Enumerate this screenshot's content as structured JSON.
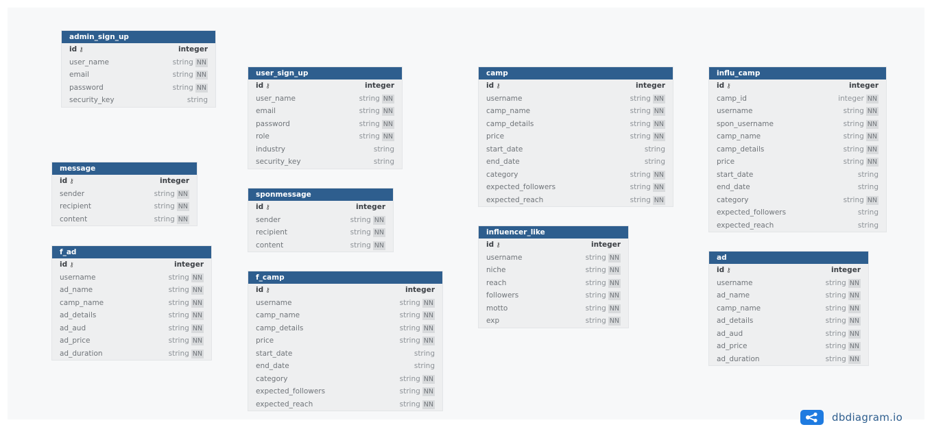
{
  "tables": [
    {
      "name": "admin_sign_up",
      "fields": [
        {
          "name": "id",
          "type": "integer",
          "pk": true
        },
        {
          "name": "user_name",
          "type": "string",
          "nn": true
        },
        {
          "name": "email",
          "type": "string",
          "nn": true
        },
        {
          "name": "password",
          "type": "string",
          "nn": true
        },
        {
          "name": "security_key",
          "type": "string"
        }
      ]
    },
    {
      "name": "message",
      "fields": [
        {
          "name": "id",
          "type": "integer",
          "pk": true
        },
        {
          "name": "sender",
          "type": "string",
          "nn": true
        },
        {
          "name": "recipient",
          "type": "string",
          "nn": true
        },
        {
          "name": "content",
          "type": "string",
          "nn": true
        }
      ]
    },
    {
      "name": "f_ad",
      "fields": [
        {
          "name": "id",
          "type": "integer",
          "pk": true
        },
        {
          "name": "username",
          "type": "string",
          "nn": true
        },
        {
          "name": "ad_name",
          "type": "string",
          "nn": true
        },
        {
          "name": "camp_name",
          "type": "string",
          "nn": true
        },
        {
          "name": "ad_details",
          "type": "string",
          "nn": true
        },
        {
          "name": "ad_aud",
          "type": "string",
          "nn": true
        },
        {
          "name": "ad_price",
          "type": "string",
          "nn": true
        },
        {
          "name": "ad_duration",
          "type": "string",
          "nn": true
        }
      ]
    },
    {
      "name": "user_sign_up",
      "fields": [
        {
          "name": "id",
          "type": "integer",
          "pk": true
        },
        {
          "name": "user_name",
          "type": "string",
          "nn": true
        },
        {
          "name": "email",
          "type": "string",
          "nn": true
        },
        {
          "name": "password",
          "type": "string",
          "nn": true
        },
        {
          "name": "role",
          "type": "string",
          "nn": true
        },
        {
          "name": "industry",
          "type": "string"
        },
        {
          "name": "security_key",
          "type": "string"
        }
      ]
    },
    {
      "name": "sponmessage",
      "fields": [
        {
          "name": "id",
          "type": "integer",
          "pk": true
        },
        {
          "name": "sender",
          "type": "string",
          "nn": true
        },
        {
          "name": "recipient",
          "type": "string",
          "nn": true
        },
        {
          "name": "content",
          "type": "string",
          "nn": true
        }
      ]
    },
    {
      "name": "f_camp",
      "fields": [
        {
          "name": "id",
          "type": "integer",
          "pk": true
        },
        {
          "name": "username",
          "type": "string",
          "nn": true
        },
        {
          "name": "camp_name",
          "type": "string",
          "nn": true
        },
        {
          "name": "camp_details",
          "type": "string",
          "nn": true
        },
        {
          "name": "price",
          "type": "string",
          "nn": true
        },
        {
          "name": "start_date",
          "type": "string"
        },
        {
          "name": "end_date",
          "type": "string"
        },
        {
          "name": "category",
          "type": "string",
          "nn": true
        },
        {
          "name": "expected_followers",
          "type": "string",
          "nn": true
        },
        {
          "name": "expected_reach",
          "type": "string",
          "nn": true
        }
      ]
    },
    {
      "name": "camp",
      "fields": [
        {
          "name": "id",
          "type": "integer",
          "pk": true
        },
        {
          "name": "username",
          "type": "string",
          "nn": true
        },
        {
          "name": "camp_name",
          "type": "string",
          "nn": true
        },
        {
          "name": "camp_details",
          "type": "string",
          "nn": true
        },
        {
          "name": "price",
          "type": "string",
          "nn": true
        },
        {
          "name": "start_date",
          "type": "string"
        },
        {
          "name": "end_date",
          "type": "string"
        },
        {
          "name": "category",
          "type": "string",
          "nn": true
        },
        {
          "name": "expected_followers",
          "type": "string",
          "nn": true
        },
        {
          "name": "expected_reach",
          "type": "string",
          "nn": true
        }
      ]
    },
    {
      "name": "influencer_like",
      "fields": [
        {
          "name": "id",
          "type": "integer",
          "pk": true
        },
        {
          "name": "username",
          "type": "string",
          "nn": true
        },
        {
          "name": "niche",
          "type": "string",
          "nn": true
        },
        {
          "name": "reach",
          "type": "string",
          "nn": true
        },
        {
          "name": "followers",
          "type": "string",
          "nn": true
        },
        {
          "name": "motto",
          "type": "string",
          "nn": true
        },
        {
          "name": "exp",
          "type": "string",
          "nn": true
        }
      ]
    },
    {
      "name": "influ_camp",
      "fields": [
        {
          "name": "id",
          "type": "integer",
          "pk": true
        },
        {
          "name": "camp_id",
          "type": "integer",
          "nn": true
        },
        {
          "name": "username",
          "type": "string",
          "nn": true
        },
        {
          "name": "spon_username",
          "type": "string",
          "nn": true
        },
        {
          "name": "camp_name",
          "type": "string",
          "nn": true
        },
        {
          "name": "camp_details",
          "type": "string",
          "nn": true
        },
        {
          "name": "price",
          "type": "string",
          "nn": true
        },
        {
          "name": "start_date",
          "type": "string"
        },
        {
          "name": "end_date",
          "type": "string"
        },
        {
          "name": "category",
          "type": "string",
          "nn": true
        },
        {
          "name": "expected_followers",
          "type": "string"
        },
        {
          "name": "expected_reach",
          "type": "string"
        }
      ]
    },
    {
      "name": "ad",
      "fields": [
        {
          "name": "id",
          "type": "integer",
          "pk": true
        },
        {
          "name": "username",
          "type": "string",
          "nn": true
        },
        {
          "name": "ad_name",
          "type": "string",
          "nn": true
        },
        {
          "name": "camp_name",
          "type": "string",
          "nn": true
        },
        {
          "name": "ad_details",
          "type": "string",
          "nn": true
        },
        {
          "name": "ad_aud",
          "type": "string",
          "nn": true
        },
        {
          "name": "ad_price",
          "type": "string",
          "nn": true
        },
        {
          "name": "ad_duration",
          "type": "string",
          "nn": true
        }
      ]
    }
  ],
  "labels": {
    "nn": "NN",
    "pk_icon": "key-icon"
  },
  "brand": {
    "name": "dbdiagram.io",
    "icon": "share-nodes-icon"
  },
  "colors": {
    "header": "#2e5e8e",
    "brand": "#1f7be0"
  }
}
